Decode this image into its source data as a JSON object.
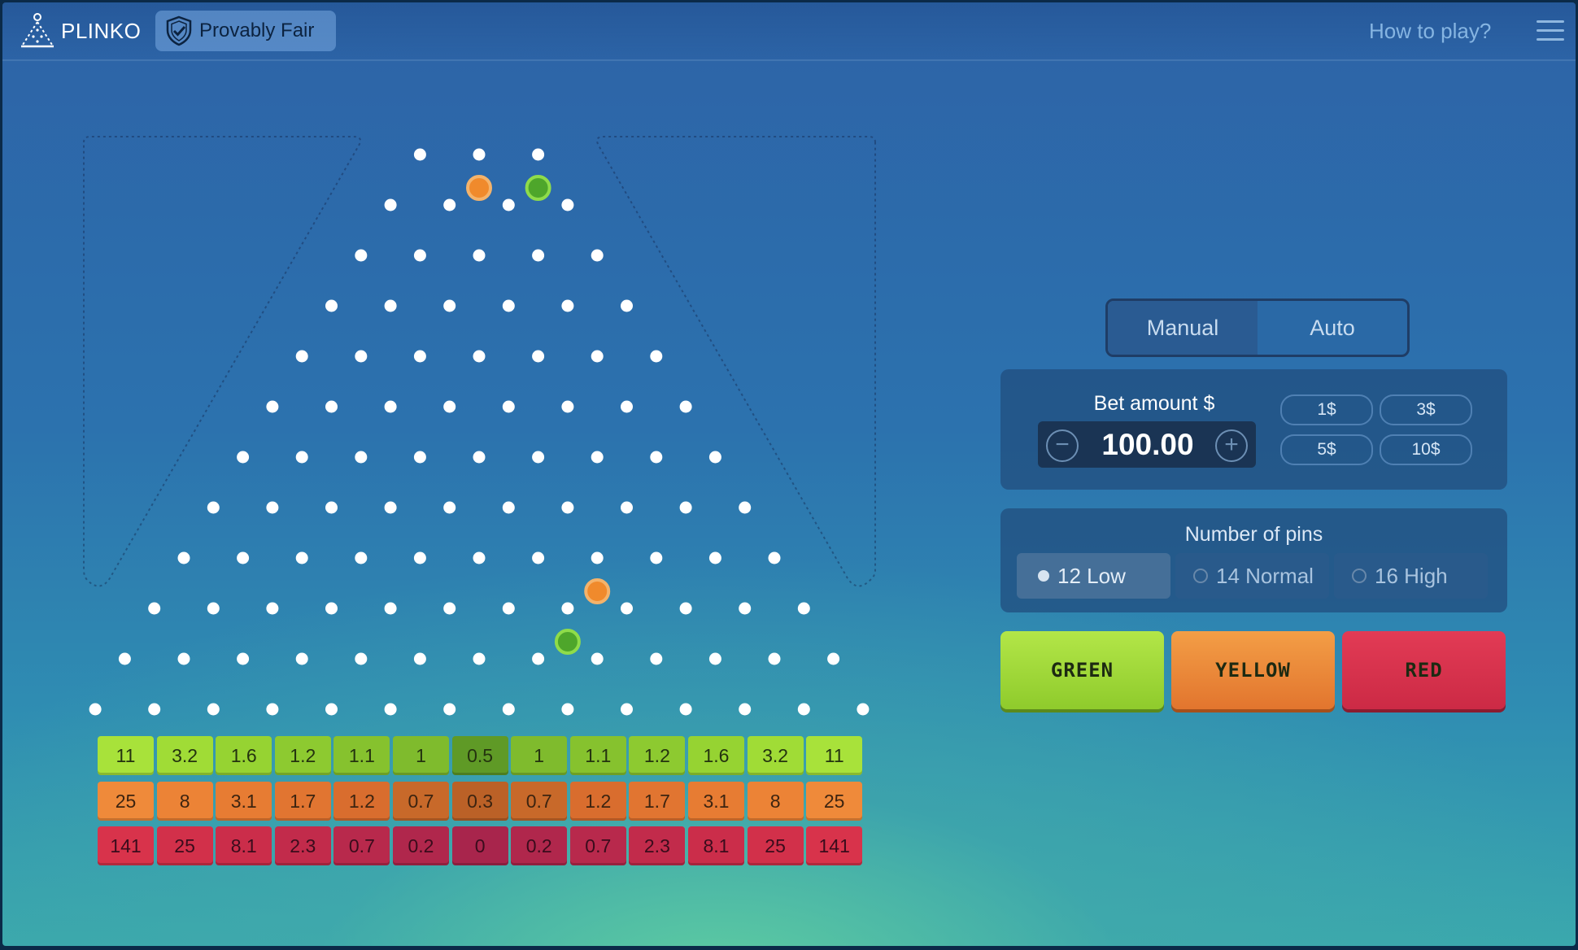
{
  "header": {
    "logo_text": "PLINKO",
    "provably_fair": "Provably Fair",
    "how_to_play": "How to play?"
  },
  "game": {
    "pins_rows": 12,
    "balls": [
      {
        "color": "orange",
        "row": 1,
        "between": [
          1,
          2
        ]
      },
      {
        "color": "green",
        "row": 1,
        "between": [
          2,
          3
        ]
      },
      {
        "color": "orange",
        "row": 9,
        "between": [
          7,
          8
        ]
      },
      {
        "color": "green",
        "row": 10,
        "between": [
          7,
          8
        ]
      }
    ]
  },
  "multipliers": {
    "green": [
      "11",
      "3.2",
      "1.6",
      "1.2",
      "1.1",
      "1",
      "0.5",
      "1",
      "1.1",
      "1.2",
      "1.6",
      "3.2",
      "11"
    ],
    "yellow": [
      "25",
      "8",
      "3.1",
      "1.7",
      "1.2",
      "0.7",
      "0.3",
      "0.7",
      "1.2",
      "1.7",
      "3.1",
      "8",
      "25"
    ],
    "red": [
      "141",
      "25",
      "8.1",
      "2.3",
      "0.7",
      "0.2",
      "0",
      "0.2",
      "0.7",
      "2.3",
      "8.1",
      "25",
      "141"
    ]
  },
  "mode": {
    "manual": "Manual",
    "auto": "Auto",
    "active": "manual"
  },
  "bet": {
    "label": "Bet amount $",
    "value": "100.00",
    "quick": [
      "1$",
      "3$",
      "5$",
      "10$"
    ]
  },
  "pins": {
    "label": "Number of pins",
    "options": [
      "12 Low",
      "14 Normal",
      "16 High"
    ],
    "selected": 0
  },
  "buttons": {
    "green": "GREEN",
    "yellow": "YELLOW",
    "red": "RED"
  },
  "colors": {
    "green_button": "#a6dc3c",
    "yellow_button": "#ec8b3a",
    "red_button": "#d8324f"
  }
}
